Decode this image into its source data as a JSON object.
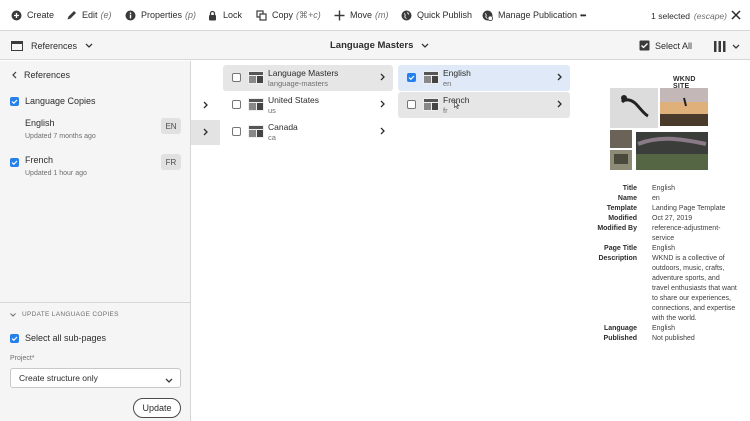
{
  "toolbar": {
    "create": "Create",
    "edit": "Edit",
    "edit_sc": "(e)",
    "properties": "Properties",
    "properties_sc": "(p)",
    "lock": "Lock",
    "copy": "Copy",
    "copy_sc": "(⌘+c)",
    "move": "Move",
    "move_sc": "(m)",
    "quick_publish": "Quick Publish",
    "manage_publication": "Manage Publication",
    "more": "•••",
    "selected": "1 selected",
    "escape": "(escape)"
  },
  "header": {
    "rail": "References",
    "title": "Language Masters",
    "select_all": "Select All"
  },
  "left": {
    "back": "References",
    "language_copies": "Language Copies",
    "languages": [
      {
        "name": "English",
        "updated": "Updated 7 months ago",
        "code": "EN",
        "checked": false
      },
      {
        "name": "French",
        "updated": "Updated 1 hour ago",
        "code": "FR",
        "checked": true
      }
    ],
    "update_header": "UPDATE LANGUAGE COPIES",
    "select_sub": "Select all sub-pages",
    "project_label": "Project*",
    "project_value": "Create structure only",
    "update_button": "Update"
  },
  "columns": {
    "col1": [
      {
        "title": "Language Masters",
        "name": "language-masters"
      },
      {
        "title": "United States",
        "name": "us"
      },
      {
        "title": "Canada",
        "name": "ca"
      }
    ],
    "col2": [
      {
        "title": "English",
        "name": "en"
      },
      {
        "title": "French",
        "name": "fr"
      }
    ]
  },
  "preview": {
    "site_title": "WKND SITE",
    "meta": [
      {
        "k": "Title",
        "v": "English"
      },
      {
        "k": "Name",
        "v": "en"
      },
      {
        "k": "Template",
        "v": "Landing Page Template"
      },
      {
        "k": "Modified",
        "v": "Oct 27, 2019"
      },
      {
        "k": "Modified By",
        "v": "reference-adjustment-service"
      },
      {
        "k": "Page Title",
        "v": "English"
      },
      {
        "k": "Description",
        "v": "WKND is a collective of outdoors, music, crafts, adventure sports, and travel enthusiasts that want to share our experiences, connections, and expertise with the world."
      },
      {
        "k": "Language",
        "v": "English"
      },
      {
        "k": "Published",
        "v": "Not published"
      }
    ]
  },
  "colors": {
    "accent": "#2680eb",
    "selected_row": "#dfe9f7",
    "hover_row": "#e6e6e6",
    "panel_bg": "#f5f5f5"
  }
}
